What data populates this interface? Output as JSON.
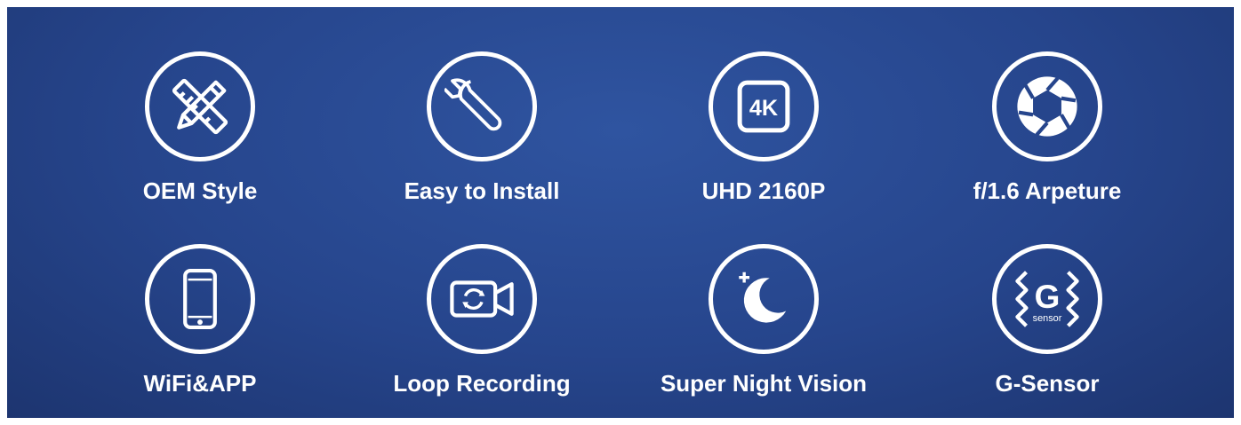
{
  "features": [
    {
      "label": "OEM Style",
      "icon": "pencil-ruler-icon"
    },
    {
      "label": "Easy to Install",
      "icon": "wrench-icon"
    },
    {
      "label": "UHD 2160P",
      "icon": "4k-icon",
      "icon_text": "4K"
    },
    {
      "label": "f/1.6 Arpeture",
      "icon": "aperture-icon"
    },
    {
      "label": "WiFi&APP",
      "icon": "smartphone-icon"
    },
    {
      "label": "Loop Recording",
      "icon": "loop-camera-icon"
    },
    {
      "label": "Super Night Vision",
      "icon": "moon-stars-icon"
    },
    {
      "label": "G-Sensor",
      "icon": "g-sensor-icon",
      "icon_text": "G",
      "icon_subtext": "sensor"
    }
  ],
  "colors": {
    "background": "#26458c",
    "foreground": "#ffffff"
  }
}
